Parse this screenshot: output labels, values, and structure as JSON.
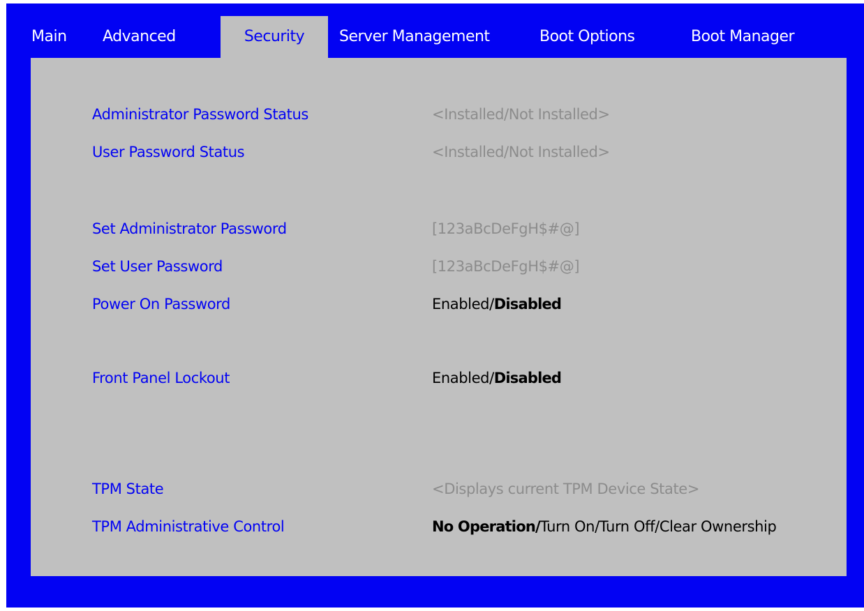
{
  "tabs": [
    "Main",
    "Advanced",
    "Security",
    "Server Management",
    "Boot Options",
    "Boot Manager"
  ],
  "active_tab": "Security",
  "colors": {
    "background": "#0202f3",
    "panel": "#c0c0c0",
    "label_text": "#0202f3",
    "readonly_text": "#8c8c8c",
    "option_text": "#000000"
  },
  "settings": {
    "admin_password_status": {
      "label": "Administrator Password Status",
      "value": "<Installed/Not Installed>"
    },
    "user_password_status": {
      "label": "User Password Status",
      "value": "<Installed/Not Installed>"
    },
    "set_admin_password": {
      "label": "Set Administrator Password",
      "value": "[123aBcDeFgH$#@]"
    },
    "set_user_password": {
      "label": "Set User Password",
      "value": "[123aBcDeFgH$#@]"
    },
    "power_on_password": {
      "label": "Power On Password",
      "options": [
        "Enabled",
        "Disabled"
      ],
      "default": "Disabled"
    },
    "front_panel_lockout": {
      "label": "Front Panel Lockout",
      "options": [
        "Enabled",
        "Disabled"
      ],
      "default": "Disabled"
    },
    "tpm_state": {
      "label": "TPM State",
      "value": "<Displays current TPM Device State>"
    },
    "tpm_admin_control": {
      "label": "TPM Administrative Control",
      "options": [
        "No Operation",
        "Turn On",
        "Turn Off",
        "Clear Ownership"
      ],
      "default": "No Operation"
    }
  }
}
